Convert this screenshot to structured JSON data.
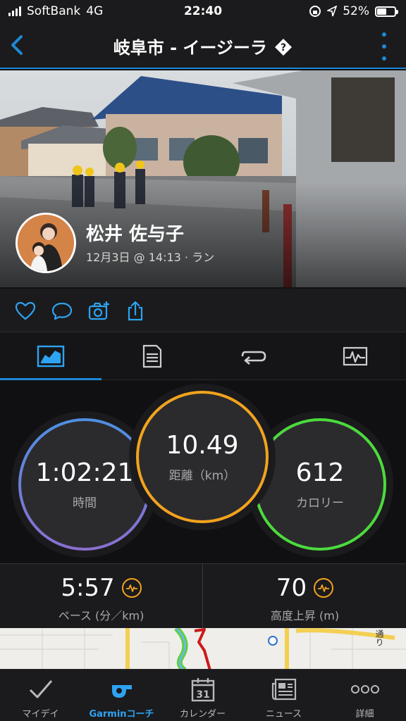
{
  "status_bar": {
    "carrier": "SoftBank",
    "network": "4G",
    "time": "22:40",
    "battery": "52%"
  },
  "nav": {
    "title": "岐阜市 - イージーラ",
    "title_icon": "question-diamond-icon",
    "back_icon": "chevron-left-icon",
    "more_icon": "vertical-ellipsis-icon",
    "accent_color": "#1e88d6"
  },
  "activity": {
    "user_name": "松井 佐与子",
    "meta": "12月3日 @ 14:13 · ラン"
  },
  "social_icons": [
    "heart-icon",
    "comment-icon",
    "add-photo-icon",
    "share-icon"
  ],
  "tabs": [
    {
      "icon": "overview-chart-icon",
      "active": true
    },
    {
      "icon": "details-list-icon",
      "active": false
    },
    {
      "icon": "laps-loop-icon",
      "active": false
    },
    {
      "icon": "graph-icon",
      "active": false
    }
  ],
  "metrics": {
    "time": {
      "value": "1:02:21",
      "label": "時間",
      "color": "#7f7fd8"
    },
    "distance": {
      "value": "10.49",
      "label": "距離（km）",
      "color": "#f2a31e"
    },
    "calories": {
      "value": "612",
      "label": "カロリー",
      "color": "#4cdb3c"
    }
  },
  "stats": {
    "pace": {
      "value": "5:57",
      "label": "ペース (分／km)"
    },
    "elevation": {
      "value": "70",
      "label": "高度上昇 (m)"
    }
  },
  "map": {
    "label": "通り"
  },
  "bottom_nav": [
    {
      "label": "マイデイ",
      "icon": "checkmark-icon",
      "active": false
    },
    {
      "label": "Garminコーチ",
      "icon": "whistle-icon",
      "active": true
    },
    {
      "label": "カレンダー",
      "icon": "calendar-icon",
      "calendar_day": "31",
      "active": false
    },
    {
      "label": "ニュース",
      "icon": "news-icon",
      "active": false
    },
    {
      "label": "詳細",
      "icon": "more-icon",
      "active": false
    }
  ]
}
